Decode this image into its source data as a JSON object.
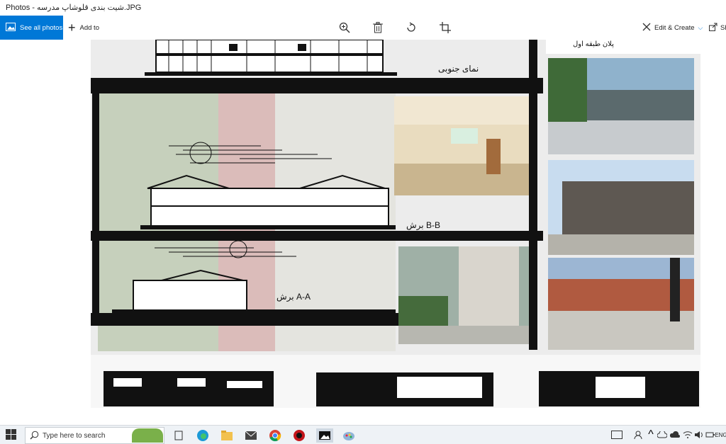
{
  "window": {
    "title": "Photos - شیت بندی قلوشاپ مدرسه.JPG"
  },
  "toolbar": {
    "see_all_label": "See all photos",
    "add_to_label": "Add to",
    "edit_create_label": "Edit & Create",
    "share_label": "Sh"
  },
  "sheet": {
    "labels": {
      "south_facade": "نمای جنوبی",
      "first_floor_plan": "پلان طبقه اول",
      "section_bb": "برش B-B",
      "section_aa": "برش A-A"
    }
  },
  "taskbar": {
    "search_placeholder": "Type here to search",
    "lang": "ENG"
  },
  "colors": {
    "accent": "#0078d7"
  }
}
